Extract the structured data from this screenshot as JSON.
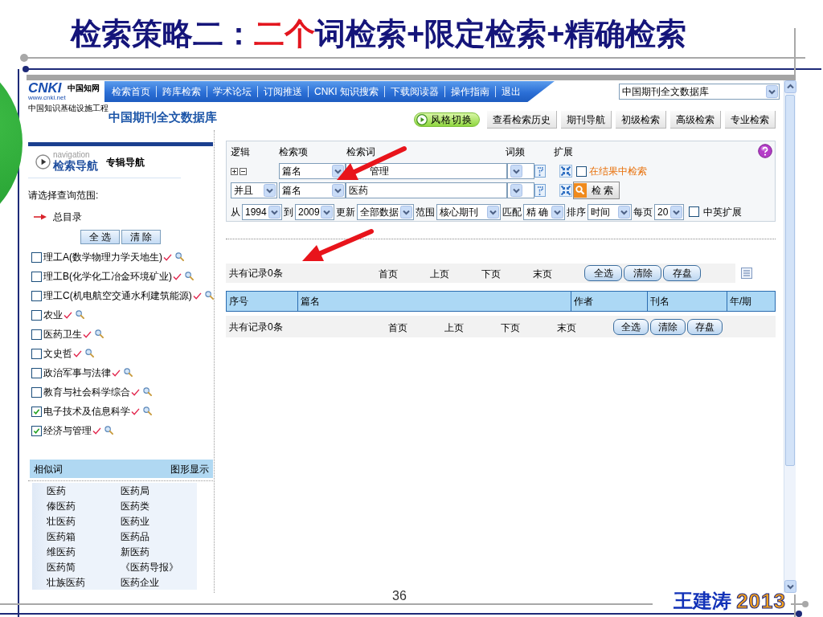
{
  "slide": {
    "title": [
      {
        "text": "检索策略二：",
        "highlight": false
      },
      {
        "text": "二个",
        "highlight": true
      },
      {
        "text": "词检索+限定检索+精确检索",
        "highlight": false
      }
    ]
  },
  "header": {
    "logo": {
      "mark": "CNKI",
      "name": "中国知网",
      "url": "www.cnki.net",
      "tagline": "中国知识基础设施工程"
    },
    "nav_links": [
      "检索首页",
      "跨库检索",
      "学术论坛",
      "订阅推送",
      "CNKI 知识搜索",
      "下载阅读器",
      "操作指南",
      "退出"
    ],
    "database_select": "中国期刊全文数据库",
    "database_title": "中国期刊全文数据库",
    "style_switch": "风格切换",
    "tabs": [
      "查看检索历史",
      "期刊导航",
      "初级检索",
      "高级检索",
      "专业检索"
    ]
  },
  "sidebar": {
    "nav_caption": "navigation",
    "nav_title": "检索导航",
    "nav_alt": "专辑导航",
    "scope_label": "请选择查询范围:",
    "root": "总目录",
    "buttons": [
      "全 选",
      "清 除"
    ],
    "categories": [
      {
        "label": "理工A(数学物理力学天地生)",
        "checked": false
      },
      {
        "label": "理工B(化学化工冶金环境矿业)",
        "checked": false
      },
      {
        "label": "理工C(机电航空交通水利建筑能源)",
        "checked": false
      },
      {
        "label": "农业",
        "checked": false
      },
      {
        "label": "医药卫生",
        "checked": false
      },
      {
        "label": "文史哲",
        "checked": false
      },
      {
        "label": "政治军事与法律",
        "checked": false
      },
      {
        "label": "教育与社会科学综合",
        "checked": false
      },
      {
        "label": "电子技术及信息科学",
        "checked": true
      },
      {
        "label": "经济与管理",
        "checked": true
      }
    ],
    "similar": {
      "title": "相似词",
      "graph_link": "图形显示",
      "words": [
        "医药",
        "医药局",
        "傣医药",
        "医药类",
        "壮医药",
        "医药业",
        "医药箱",
        "医药品",
        "维医药",
        "新医药",
        "医药简",
        "《医药导报》",
        "壮族医药",
        "医药企业"
      ]
    }
  },
  "search_form": {
    "headers": [
      "逻辑",
      "检索项",
      "检索词",
      "词频",
      "扩展"
    ],
    "rows": [
      {
        "kind": "first",
        "field": "篇名",
        "term": "管理"
      },
      {
        "kind": "next",
        "logic": "并且",
        "field": "篇名",
        "term": "医药"
      }
    ],
    "in_results": {
      "label": "在结果中检索",
      "checked": false
    },
    "search_button": "检 索",
    "filters": [
      {
        "label": "从",
        "value": "1994"
      },
      {
        "label": "到",
        "value": "2009"
      },
      {
        "label": "更新",
        "value": "全部数据"
      },
      {
        "label": "范围",
        "value": "核心期刊"
      },
      {
        "label": "匹配",
        "value": "精 确"
      },
      {
        "label": "排序",
        "value": "时间"
      },
      {
        "label": "每页",
        "value": "20"
      }
    ],
    "bilingual": {
      "label": "中英扩展",
      "checked": false
    }
  },
  "results": {
    "top": {
      "summary": "共有记录0条",
      "pager": [
        "首页",
        "上页",
        "下页",
        "末页"
      ],
      "buttons": [
        "全选",
        "清除",
        "存盘"
      ]
    },
    "columns": [
      "序号",
      "篇名",
      "作者",
      "刊名",
      "年/期"
    ],
    "bottom": {
      "summary": "共有记录0条",
      "pager": [
        "首页",
        "上页",
        "下页",
        "末页"
      ],
      "buttons": [
        "全选",
        "清除",
        "存盘"
      ]
    }
  },
  "footer": {
    "page_number": "36",
    "author": "王建涛",
    "year": "2013"
  }
}
